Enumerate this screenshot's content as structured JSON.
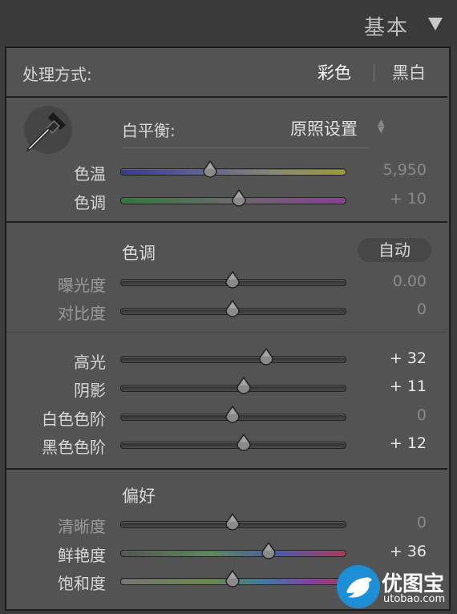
{
  "header": {
    "title": "基本"
  },
  "treatment": {
    "label": "处理方式:",
    "options": [
      "彩色",
      "黑白"
    ],
    "selected": "彩色"
  },
  "white_balance": {
    "label": "白平衡:",
    "value": "原照设置",
    "sliders": [
      {
        "label": "色温",
        "value": "5,950",
        "position": 0.4
      },
      {
        "label": "色调",
        "value": "+ 10",
        "position": 0.53
      }
    ]
  },
  "tone": {
    "label": "色调",
    "auto_label": "自动",
    "sliders_top": [
      {
        "label": "曝光度",
        "value": "0.00",
        "position": 0.5
      },
      {
        "label": "对比度",
        "value": "0",
        "position": 0.5
      }
    ],
    "sliders_bottom": [
      {
        "label": "高光",
        "value": "+ 32",
        "position": 0.65
      },
      {
        "label": "阴影",
        "value": "+ 11",
        "position": 0.55
      },
      {
        "label": "白色色阶",
        "value": "0",
        "position": 0.5
      },
      {
        "label": "黑色色阶",
        "value": "+ 12",
        "position": 0.55
      }
    ]
  },
  "presence": {
    "label": "偏好",
    "sliders": [
      {
        "label": "清晰度",
        "value": "0",
        "position": 0.5
      },
      {
        "label": "鲜艳度",
        "value": "+ 36",
        "position": 0.66
      },
      {
        "label": "饱和度",
        "value": "",
        "position": 0.5
      }
    ]
  },
  "watermark": {
    "text": "优图宝",
    "url": "utobao.com"
  },
  "colors": {
    "panel": "#535353",
    "background": "#3a3a3a",
    "watermark_blue": "#1d8fd6"
  }
}
